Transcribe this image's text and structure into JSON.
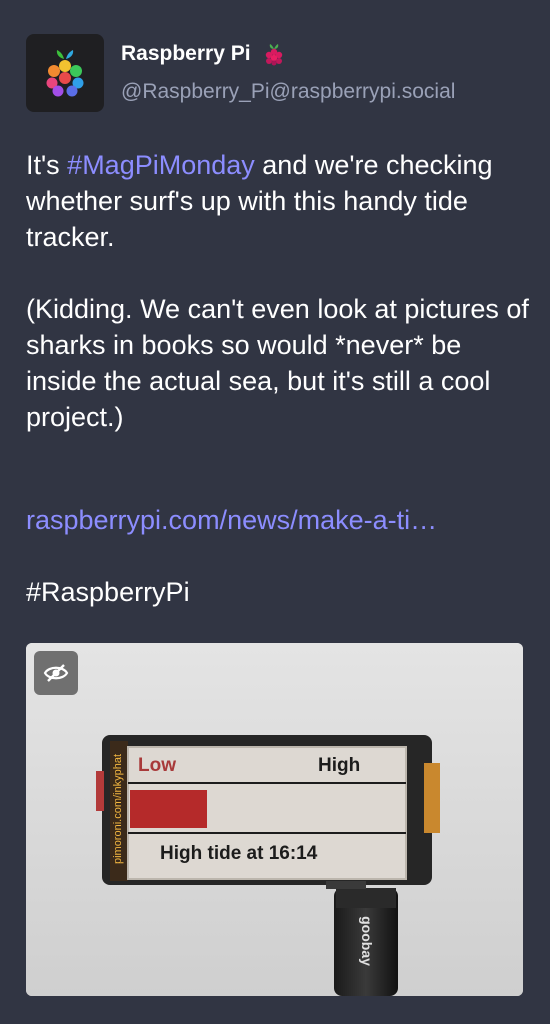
{
  "post": {
    "author_name": "Raspberry Pi",
    "author_handle": "@Raspberry_Pi@raspberrypi.social",
    "hashtag_inline": "#MagPiMonday",
    "text_before_tag": "It's ",
    "text_after_tag": " and we're checking whether surf's up with this handy tide tracker.",
    "paragraph2": "(Kidding. We can't even look at pictures of sharks in books so would *never* be inside the actual sea, but it's still a cool project.)",
    "link_text": "raspberrypi.com/news/make-a-ti…",
    "hashtag_footer": "#RaspberryPi"
  },
  "media": {
    "hide_icon": "eye-slash-icon",
    "screen_low": "Low",
    "screen_high": "High",
    "screen_status": "High tide at 16:14",
    "side_label": "pimoroni.com/inkyphat",
    "plug_brand": "goobay",
    "tide_level": 0.28
  },
  "colors": {
    "background": "#313543",
    "link": "#8c8dff",
    "handle": "#9aa1b7"
  }
}
